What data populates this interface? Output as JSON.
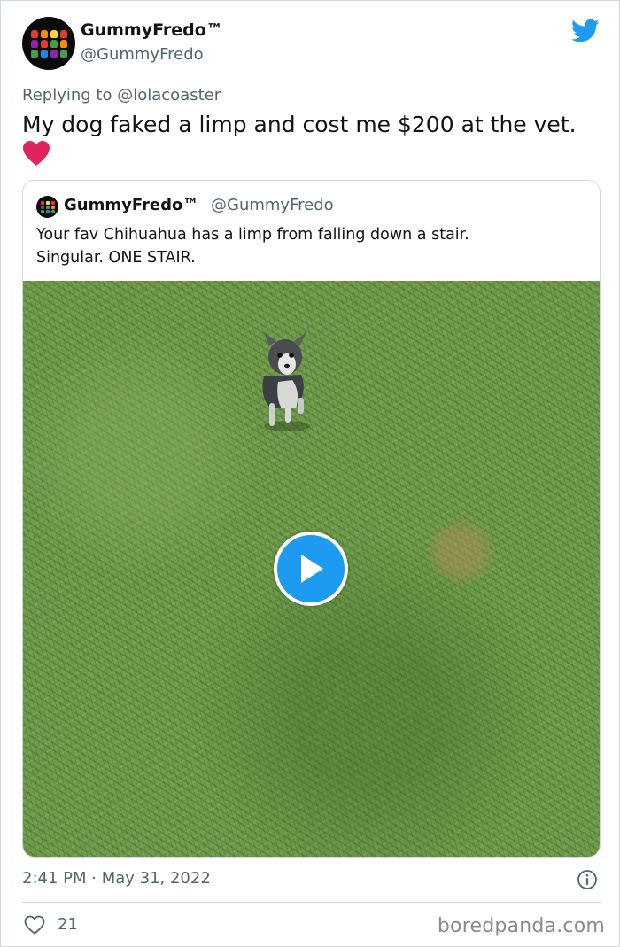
{
  "author": {
    "display_name": "GummyFredo™",
    "handle": "@GummyFredo"
  },
  "reply": {
    "prefix": "Replying to",
    "mention": "@lolacoaster"
  },
  "tweet": {
    "text": "My dog faked a limp and cost me $200 at the vet.",
    "emoji": "red-heart-icon"
  },
  "quoted_tweet": {
    "display_name": "GummyFredo™",
    "handle": "@GummyFredo",
    "line1": "Your fav Chihuahua has a limp from falling down a stair.",
    "line2": "Singular. ONE STAIR.",
    "media": "video-thumbnail-dog-on-grass"
  },
  "meta": {
    "timestamp": "2:41 PM · May 31, 2022",
    "info_icon": "info-icon"
  },
  "actions": {
    "like_count": "21"
  },
  "watermark": "boredpanda.com",
  "colors": {
    "twitter_blue": "#1d9bf0",
    "secondary_text": "#536471",
    "heart_red": "#e0245e"
  }
}
